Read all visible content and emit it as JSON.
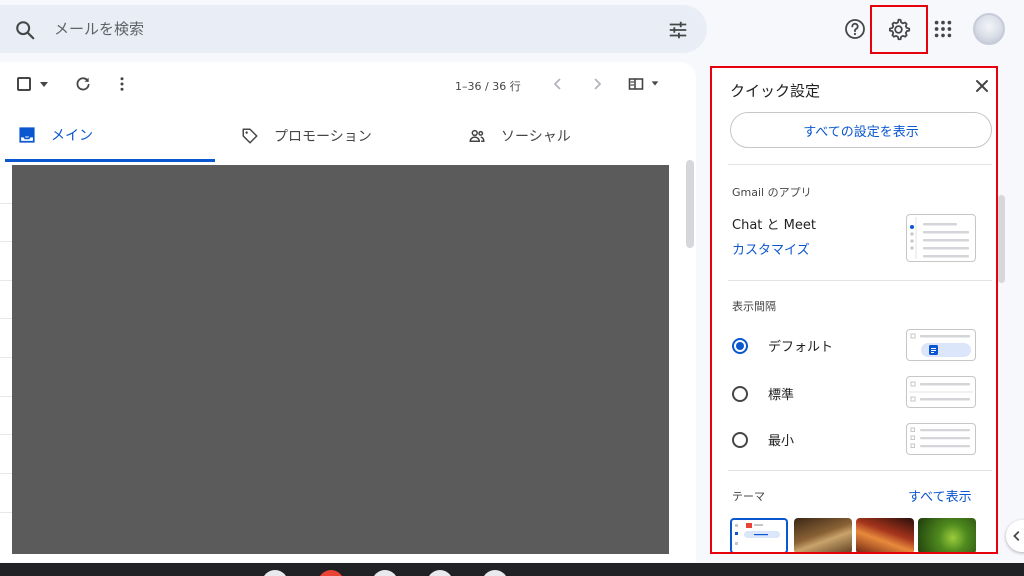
{
  "header": {
    "search_placeholder": "メールを検索",
    "icons": [
      "search-icon",
      "filter-icon",
      "help-icon",
      "settings-icon",
      "apps-icon",
      "avatar"
    ]
  },
  "toolbar": {
    "page_info": "1–36 / 36 行"
  },
  "tabs": [
    {
      "label": "メイン",
      "icon": "inbox-icon",
      "active": true
    },
    {
      "label": "プロモーション",
      "icon": "tag-icon",
      "active": false
    },
    {
      "label": "ソーシャル",
      "icon": "people-icon",
      "active": false
    }
  ],
  "quick_settings": {
    "title": "クイック設定",
    "all_settings_button": "すべての設定を表示",
    "apps_heading": "Gmail のアプリ",
    "chat_meet": "Chat と Meet",
    "customize": "カスタマイズ",
    "density_heading": "表示間隔",
    "density_options": [
      {
        "label": "デフォルト",
        "selected": true
      },
      {
        "label": "標準",
        "selected": false
      },
      {
        "label": "最小",
        "selected": false
      }
    ],
    "theme_heading": "テーマ",
    "theme_all": "すべて表示"
  },
  "colors": {
    "accent": "#0b57d0",
    "highlight": "#e8000c",
    "redacted": "#5b5b5b"
  }
}
